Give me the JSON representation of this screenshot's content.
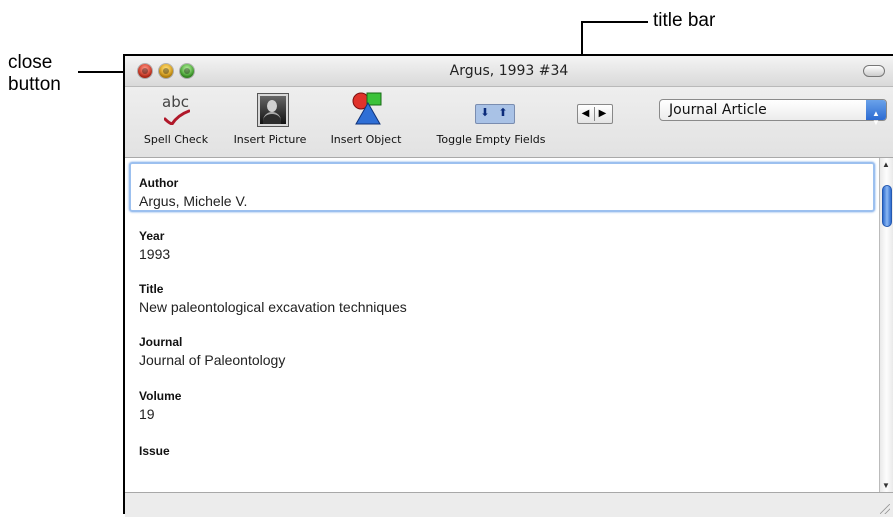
{
  "annotations": {
    "title_bar_callout": "title bar",
    "close_button_callout_line1": "close",
    "close_button_callout_line2": "button"
  },
  "window": {
    "title": "Argus, 1993 #34"
  },
  "toolbar": {
    "spell_check_label": "Spell Check",
    "spell_check_icon_text": "abc",
    "insert_picture_label": "Insert Picture",
    "insert_object_label": "Insert Object",
    "toggle_empty_fields_label": "Toggle Empty Fields",
    "reference_type": "Journal Article"
  },
  "fields": [
    {
      "name": "Author",
      "value": "Argus, Michele V."
    },
    {
      "name": "Year",
      "value": "1993"
    },
    {
      "name": "Title",
      "value": "New paleontological excavation techniques"
    },
    {
      "name": "Journal",
      "value": "Journal of Paleontology"
    },
    {
      "name": "Volume",
      "value": "19"
    },
    {
      "name": "Issue",
      "value": ""
    }
  ],
  "colors": {
    "focus_ring": "#9cc0ef",
    "close_button": "#d0301c",
    "minimize_button": "#d89a10",
    "zoom_button": "#3ea52a",
    "selector_accent": "#2c6bd2"
  }
}
